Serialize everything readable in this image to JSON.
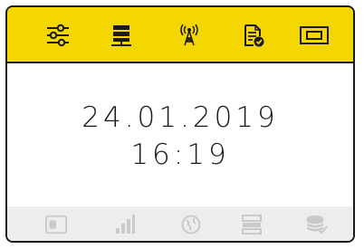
{
  "screen": {
    "date": "24.01.2019",
    "time": "16:19"
  },
  "top_bar": {
    "background": "#f4d600",
    "icons": [
      "settings-sliders-icon",
      "server-icon",
      "antenna-icon",
      "document-check-icon",
      "display-frame-icon"
    ],
    "active_icon": "none"
  },
  "bottom_bar": {
    "background": "#ededed",
    "icon_color": "#c9c9c9",
    "icons": [
      "sim-card-icon",
      "signal-bars-icon",
      "globe-icon",
      "server-stack-icon",
      "database-check-icon"
    ]
  }
}
